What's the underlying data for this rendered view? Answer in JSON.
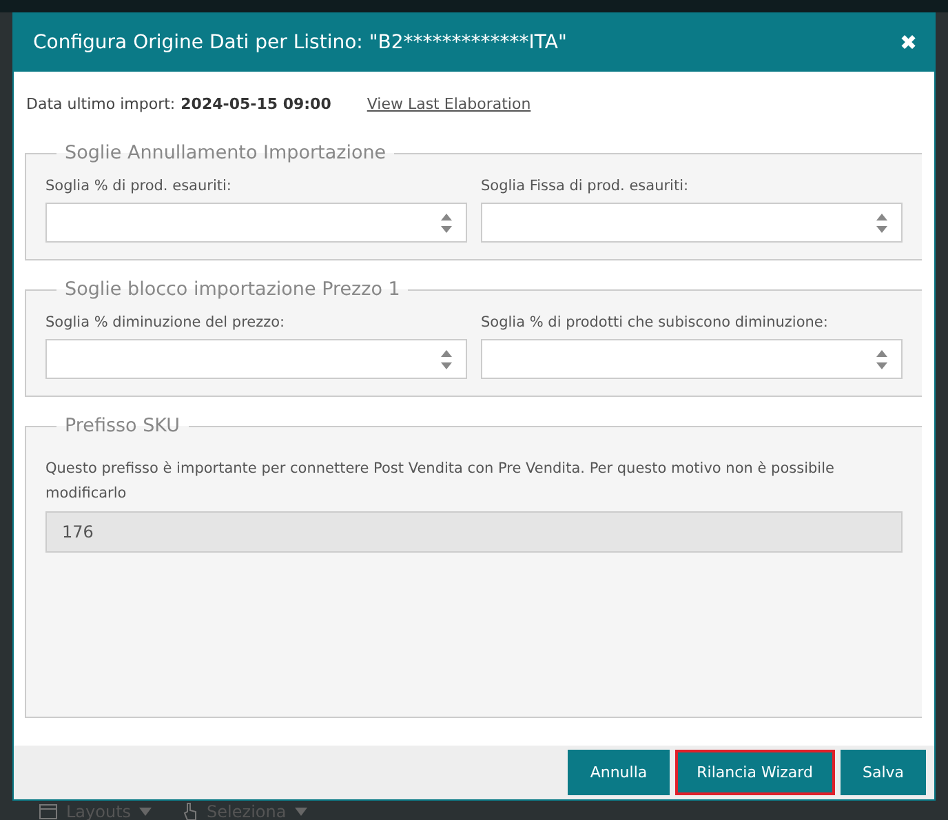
{
  "dialog": {
    "title": "Configura Origine Dati per Listino: \"B2*************ITA\"",
    "close": "✖",
    "import_info": {
      "label": "Data ultimo import:",
      "value": "2024-05-15 09:00",
      "link": "View Last Elaboration"
    },
    "sections": [
      {
        "legend": "Soglie Annullamento Importazione",
        "kind": "fields",
        "fields": [
          {
            "label": "Soglia % di prod. esauriti:"
          },
          {
            "label": "Soglia Fissa di prod. esauriti:"
          }
        ]
      },
      {
        "legend": "Soglie blocco importazione Prezzo 1",
        "kind": "fields",
        "fields": [
          {
            "label": "Soglia % diminuzione del prezzo:"
          },
          {
            "label": "Soglia % di prodotti che subiscono diminuzione:"
          }
        ]
      },
      {
        "legend": "Prefisso SKU",
        "kind": "readonly",
        "note": "Questo prefisso è importante per connettere Post Vendita con Pre Vendita. Per questo motivo non è possibile modificarlo",
        "value": "176",
        "disabled": true
      }
    ],
    "buttons": [
      {
        "label": "Annulla",
        "highlighted": false
      },
      {
        "label": "Rilancia Wizard",
        "highlighted": true
      },
      {
        "label": "Salva",
        "highlighted": false
      }
    ]
  },
  "background_toolbar": [
    {
      "label": "Layouts"
    },
    {
      "label": "Seleziona"
    }
  ]
}
